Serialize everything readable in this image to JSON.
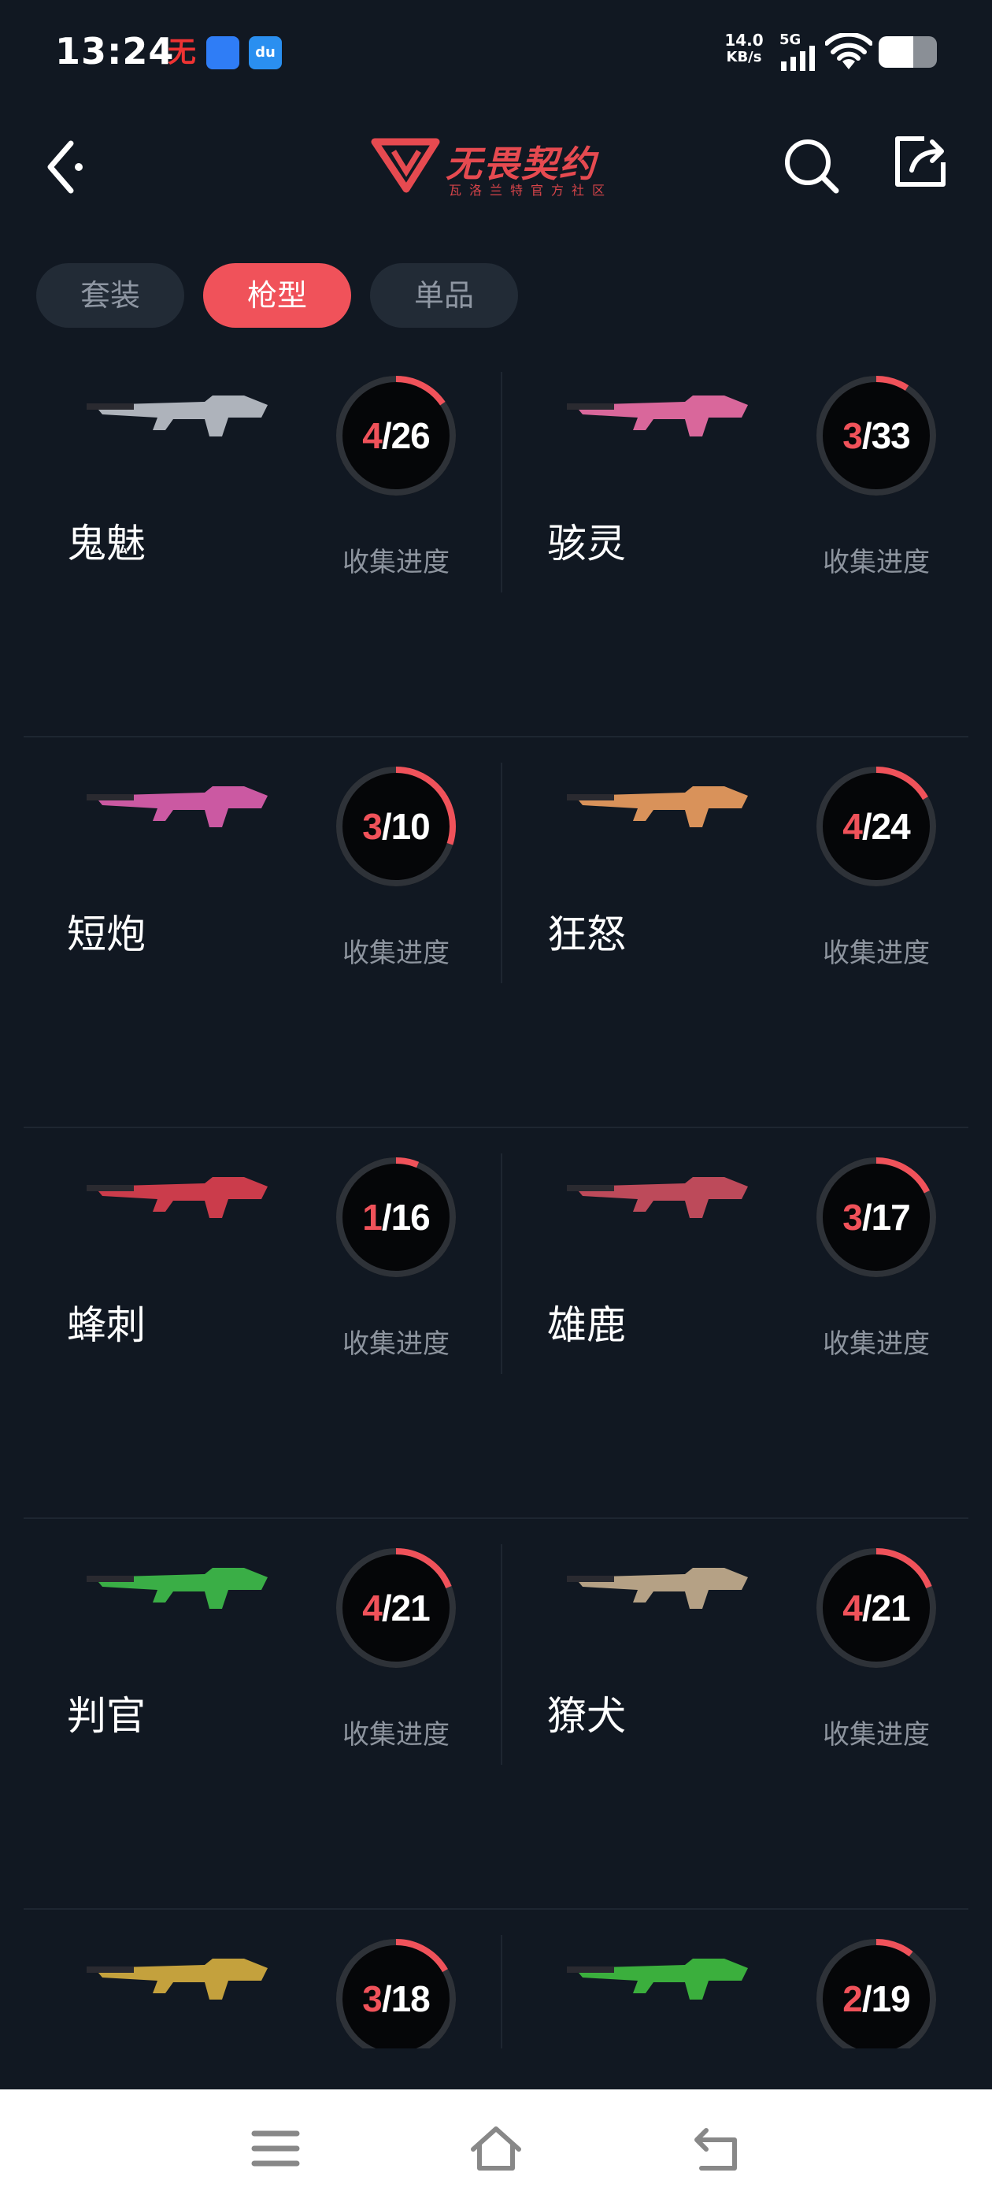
{
  "status": {
    "time": "13:24",
    "net_speed_value": "14.0",
    "net_speed_unit": "KB/s",
    "network": "5G",
    "battery_level": 0.6,
    "notif_icons": [
      "game-app-icon",
      "message-app-icon",
      "du-app-icon"
    ],
    "du_label": "du"
  },
  "header": {
    "logo_text": "无畏契约",
    "logo_sub": "瓦洛兰特官方社区",
    "brand_color": "#e64a50"
  },
  "tabs": [
    {
      "label": "套装",
      "active": false
    },
    {
      "label": "枪型",
      "active": true
    },
    {
      "label": "单品",
      "active": false
    }
  ],
  "progress_label": "收集进度",
  "weapons": [
    {
      "name": "鬼魅",
      "collected": "4",
      "total": "26",
      "ratio": 0.154,
      "color": "#c0c4cc"
    },
    {
      "name": "骇灵",
      "collected": "3",
      "total": "33",
      "ratio": 0.091,
      "color": "#f070a8"
    },
    {
      "name": "短炮",
      "collected": "3",
      "total": "10",
      "ratio": 0.3,
      "color": "#e060b0"
    },
    {
      "name": "狂怒",
      "collected": "4",
      "total": "24",
      "ratio": 0.167,
      "color": "#f0a060"
    },
    {
      "name": "蜂刺",
      "collected": "1",
      "total": "16",
      "ratio": 0.0625,
      "color": "#e04050"
    },
    {
      "name": "雄鹿",
      "collected": "3",
      "total": "17",
      "ratio": 0.176,
      "color": "#d05060"
    },
    {
      "name": "判官",
      "collected": "4",
      "total": "21",
      "ratio": 0.19,
      "color": "#3fbf4a"
    },
    {
      "name": "獠犬",
      "collected": "4",
      "total": "21",
      "ratio": 0.19,
      "color": "#c8b090"
    },
    {
      "name": "",
      "collected": "3",
      "total": "18",
      "ratio": 0.167,
      "color": "#d8b040"
    },
    {
      "name": "",
      "collected": "2",
      "total": "19",
      "ratio": 0.105,
      "color": "#40c040"
    }
  ],
  "colors": {
    "accent": "#f0525a",
    "ring_track": "#2e3238",
    "background": "#111822"
  },
  "navbar": {
    "icons": [
      "menu-icon",
      "home-icon",
      "back-return-icon"
    ]
  }
}
